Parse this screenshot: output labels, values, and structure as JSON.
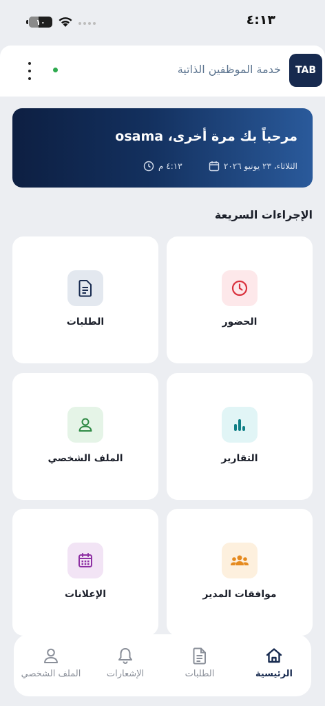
{
  "status_bar": {
    "battery_level": "١٠",
    "time": "٤:١٣"
  },
  "header": {
    "logo_text": "TAB",
    "title": "خدمة الموظفين الذاتية"
  },
  "welcome": {
    "greeting": "مرحباً بك مرة أخرى، osama",
    "date": "الثلاثاء، ٢٣ يونيو ٢٠٢٦",
    "time": "٤:١٣ م"
  },
  "quick_actions": {
    "title": "الإجراءات السريعة",
    "items": [
      {
        "label": "الحضور",
        "icon": "clock-icon",
        "color": "#d9313d",
        "bg": "#fde8ea"
      },
      {
        "label": "الطلبات",
        "icon": "document-icon",
        "color": "#172a4f",
        "bg": "#e3e8ef"
      },
      {
        "label": "التقارير",
        "icon": "bar-chart-icon",
        "color": "#0f7f86",
        "bg": "#e1f5f6"
      },
      {
        "label": "الملف الشخصي",
        "icon": "user-icon",
        "color": "#2f8a45",
        "bg": "#e5f4e7"
      },
      {
        "label": "موافقات المدير",
        "icon": "team-icon",
        "color": "#e58a1f",
        "bg": "#fdf0de"
      },
      {
        "label": "الإعلانات",
        "icon": "calendar-icon",
        "color": "#8e2fa3",
        "bg": "#f2e4f5"
      }
    ]
  },
  "bottom_nav": {
    "items": [
      {
        "label": "الرئيسية",
        "icon": "home-icon",
        "active": true
      },
      {
        "label": "الطلبات",
        "icon": "document-icon",
        "active": false
      },
      {
        "label": "الإشعارات",
        "icon": "bell-icon",
        "active": false
      },
      {
        "label": "الملف الشخصي",
        "icon": "user-icon",
        "active": false
      }
    ]
  },
  "colors": {
    "brand": "#172a4f",
    "background": "#eceef2",
    "online": "#2eaa4f"
  }
}
